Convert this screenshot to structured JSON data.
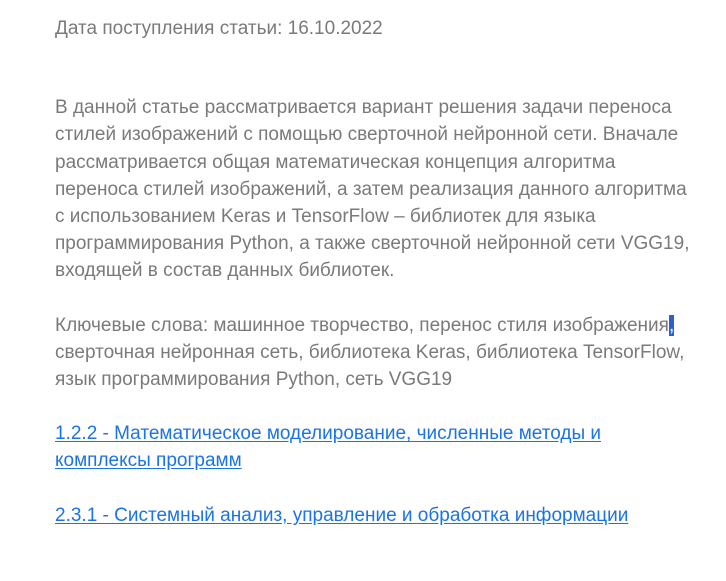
{
  "article": {
    "received_date": "Дата поступления статьи: 16.10.2022",
    "abstract_lines": [
      "В данной статье рассматривается вариант решения задачи переноса",
      "стилей изображений с помощью сверточной нейронной сети. Вначале",
      "рассматривается общая математическая концепция алгоритма",
      "переноса стилей изображений, а затем реализация данного алгоритма",
      "с использованием Keras и TensorFlow – библиотек для языка",
      "программирования Python, а также сверточной нейронной сети VGG19,",
      "входящей в состав данных библиотек."
    ],
    "keywords": {
      "line_1": "Ключевые слова: машинное творчество, перенос стиля изображения",
      "selected_char": ",",
      "line_2": "сверточная нейронная сеть, библиотека Keras, библиотека TensorFlow,",
      "line_3": "язык программирования Python, сеть VGG19"
    },
    "links": [
      {
        "line_1": "1.2.2 - Математическое моделирование, численные методы и",
        "line_2": "комплексы программ"
      },
      {
        "line_1": "2.3.1 - Системный анализ, управление и обработка информации"
      }
    ]
  },
  "colors": {
    "text": "#7a7a7a",
    "link": "#1a73e8",
    "selection": "#2b5fd9"
  }
}
